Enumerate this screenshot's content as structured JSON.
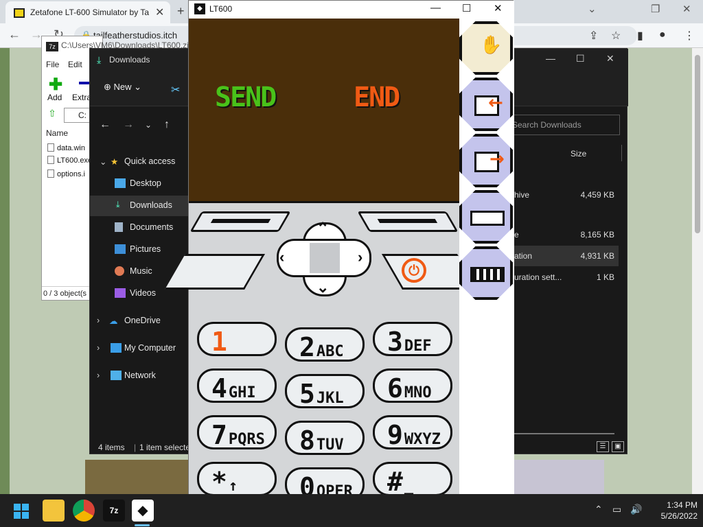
{
  "browser": {
    "tab_title": "Zetafone LT-600 Simulator by Ta",
    "tab_close": "✕",
    "new_tab": "+",
    "url": "tailfeatherstudios.itch",
    "win_minimize": "⌄",
    "win_restore": "❐",
    "win_close": "✕"
  },
  "sevenzip": {
    "title": "C:\\Users\\VM6\\Downloads\\LT600.zi",
    "logo": "7z",
    "menu": [
      "File",
      "Edit"
    ],
    "add_label": "Add",
    "extract_label": "Extra",
    "path": "C:",
    "col_name": "Name",
    "files": [
      "data.win",
      "LT600.exe",
      "options.i"
    ],
    "status": "0 / 3 object(s"
  },
  "explorer": {
    "title": "Downloads",
    "new_label": "New",
    "search_placeholder": "Search Downloads",
    "size_header": "Size",
    "nav": [
      {
        "label": "Quick access",
        "icon": "star-icon"
      },
      {
        "label": "Desktop",
        "icon": "desktop-icon"
      },
      {
        "label": "Downloads",
        "icon": "download-icon"
      },
      {
        "label": "Documents",
        "icon": "document-icon"
      },
      {
        "label": "Pictures",
        "icon": "pictures-icon"
      },
      {
        "label": "Music",
        "icon": "music-icon"
      },
      {
        "label": "Videos",
        "icon": "videos-icon"
      },
      {
        "label": "OneDrive",
        "icon": "cloud-icon"
      },
      {
        "label": "My Computer",
        "icon": "computer-icon"
      },
      {
        "label": "Network",
        "icon": "network-icon"
      }
    ],
    "rows": [
      {
        "name": "hive",
        "size": "4,459 KB"
      },
      {
        "name": "e",
        "size": "8,165 KB"
      },
      {
        "name": "ation",
        "size": "4,931 KB"
      },
      {
        "name": "uration sett...",
        "size": "1 KB"
      }
    ],
    "status_items": "4 items",
    "status_selected": "1 item selecte"
  },
  "lt600": {
    "title": "LT600",
    "send_label": "SEND",
    "end_label": "END",
    "keys": [
      {
        "digit": "1",
        "letters": ""
      },
      {
        "digit": "2",
        "letters": "ABC"
      },
      {
        "digit": "3",
        "letters": "DEF"
      },
      {
        "digit": "4",
        "letters": "GHI"
      },
      {
        "digit": "5",
        "letters": "JKL"
      },
      {
        "digit": "6",
        "letters": "MNO"
      },
      {
        "digit": "7",
        "letters": "PQRS"
      },
      {
        "digit": "8",
        "letters": "TUV"
      },
      {
        "digit": "9",
        "letters": "WXYZ"
      },
      {
        "digit": "*",
        "letters": "↑"
      },
      {
        "digit": "0",
        "letters": "OPER"
      },
      {
        "digit": "#",
        "letters": "_"
      }
    ],
    "colors": {
      "screen": "#4a2e0a",
      "send": "#49c21a",
      "end": "#f05a14",
      "button": "#c4c4ec"
    }
  },
  "taskbar": {
    "time": "1:34 PM",
    "date": "5/26/2022",
    "sevenzip_label": "7z"
  }
}
